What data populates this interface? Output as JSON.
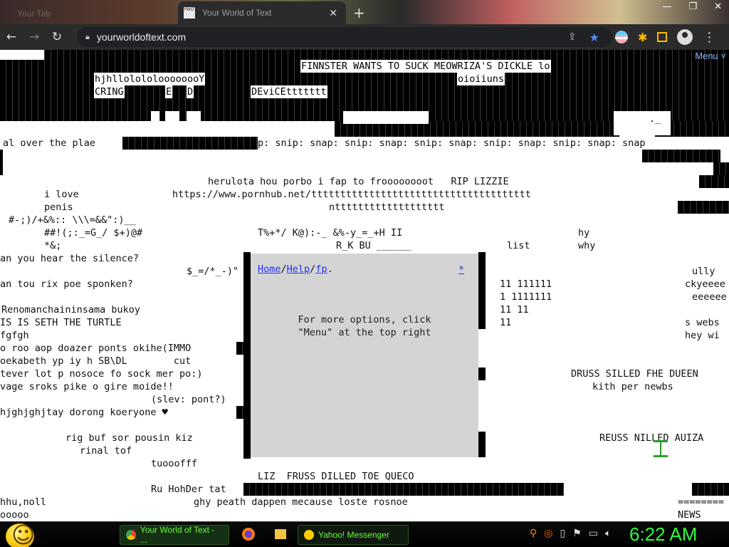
{
  "browser": {
    "inactive_tab_title": "Your Tab",
    "active_tab": {
      "favicon_text": "YWOT",
      "title": "Your World of Text",
      "close": "✕"
    },
    "new_tab": "+",
    "window_controls": {
      "minimize": "—",
      "restore": "❐",
      "close": "✕"
    },
    "url": "yourworldoftext.com"
  },
  "page": {
    "menu_label": "Menu ˅",
    "lines": [
      "FINNSTER WANTS TO SUCK MEOWRIZA'S DICKLE lo",
      "hjhllolololoooooooY",
      "oioiiuns",
      "CRING",
      "E",
      "D",
      "DEviCEttttttt",
      "._",
      "al over the plae",
      "p: snip: snap: snip: snap: snip: snap: snip: snap: snip: snap: snap",
      "herulota hou porbo i fap to froooooooot   RIP LIZZIE",
      "i love",
      "https://www.pornhub.net/tttttttttttttttttttttttttttttttttttttt",
      "penis",
      "nttttttttttttttttttt",
      "#-;)/+&%:: \\\\\\=&&\":)__",
      "##!(;:_=G_/ $+)@#",
      "T%+*/ K@):-_ &%-y_=_+H II",
      "hy",
      "*&;",
      "R_K BU ______",
      "list",
      "why",
      "an you hear the silence?",
      "$_=/*_-)\"",
      "ully",
      "an tou rix poe sponken?",
      "11 111111",
      "ckyeeee",
      "1 1111111",
      "eeeeee",
      "Renomanchaininsama bukoy",
      "11 11",
      "IS IS SETH THE TURTLE",
      "11",
      "s webs",
      "fgfgh",
      "hey wi",
      "o roo aop doazer ponts okihe(IMMO",
      "oekabeth yp iy h SB\\DL        cut",
      "tever lot p nosoce fo sock mer po:)",
      "DRUSS SILLED FHE DUEEN",
      "vage sroks pike o gire moide!!",
      "kith per newbs",
      "(slev: pont?)",
      "hjghjghjtay dorong koeryone ♥",
      "rig buf sor pousin kiz",
      "REUSS NILLED AUIZA",
      "rinal tof",
      "tuooofff",
      "LIZ  FRUSS DILLED TOE QUECO",
      "Ru HohDer tat",
      "hhu,noll",
      "ghy peath dappen mecause loste rosnoe",
      "========",
      "ooooo",
      "NEWS"
    ]
  },
  "popup": {
    "home": "Home",
    "help": "Help",
    "fp": "fp",
    "close": "*",
    "message": "For more options, click\n\"Menu\" at the top right"
  },
  "taskbar": {
    "chrome_task": "Your World of Text - ...",
    "messenger_task": "Yahoo! Messenger",
    "clock": "6:22 AM"
  }
}
